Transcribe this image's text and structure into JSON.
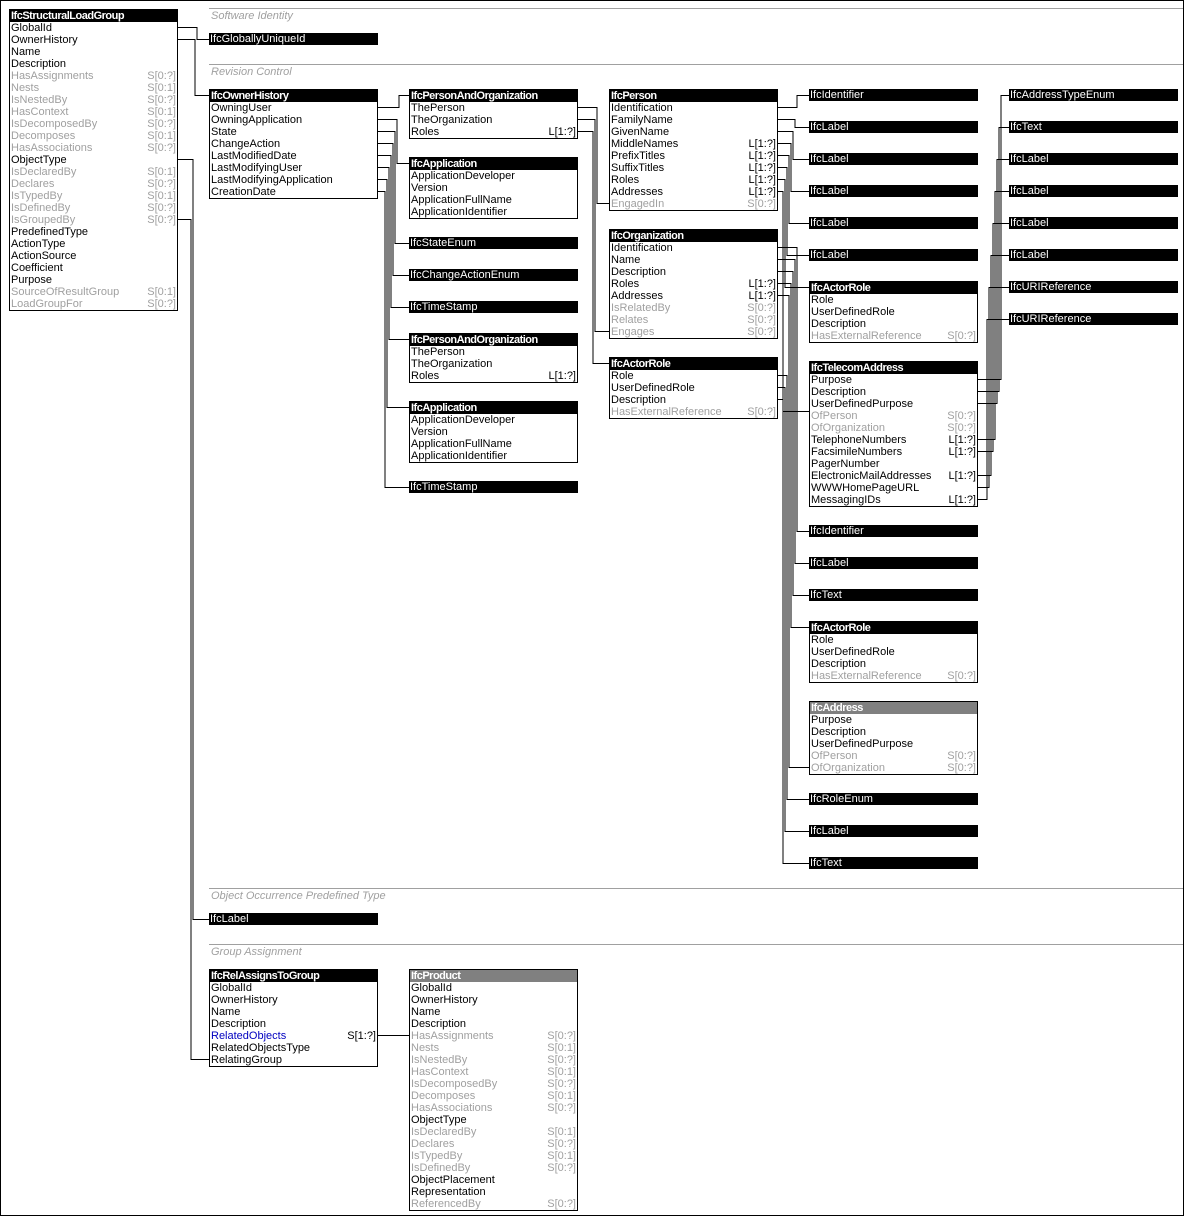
{
  "sections": [
    {
      "id": "software-identity",
      "label": "Software Identity"
    },
    {
      "id": "revision-control",
      "label": "Revision Control"
    },
    {
      "id": "object-occurrence-predefined-type",
      "label": "Object Occurrence Predefined Type"
    },
    {
      "id": "group-assignment",
      "label": "Group Assignment"
    }
  ],
  "entities": {
    "structural_load_group": {
      "name": "IfcStructuralLoadGroup",
      "attributes": [
        {
          "name": "GlobalId",
          "card": "",
          "inverse": false
        },
        {
          "name": "OwnerHistory",
          "card": "",
          "inverse": false
        },
        {
          "name": "Name",
          "card": "",
          "inverse": false
        },
        {
          "name": "Description",
          "card": "",
          "inverse": false
        },
        {
          "name": "HasAssignments",
          "card": "S[0:?]",
          "inverse": true
        },
        {
          "name": "Nests",
          "card": "S[0:1]",
          "inverse": true
        },
        {
          "name": "IsNestedBy",
          "card": "S[0:?]",
          "inverse": true
        },
        {
          "name": "HasContext",
          "card": "S[0:1]",
          "inverse": true
        },
        {
          "name": "IsDecomposedBy",
          "card": "S[0:?]",
          "inverse": true
        },
        {
          "name": "Decomposes",
          "card": "S[0:1]",
          "inverse": true
        },
        {
          "name": "HasAssociations",
          "card": "S[0:?]",
          "inverse": true
        },
        {
          "name": "ObjectType",
          "card": "",
          "inverse": false
        },
        {
          "name": "IsDeclaredBy",
          "card": "S[0:1]",
          "inverse": true
        },
        {
          "name": "Declares",
          "card": "S[0:?]",
          "inverse": true
        },
        {
          "name": "IsTypedBy",
          "card": "S[0:1]",
          "inverse": true
        },
        {
          "name": "IsDefinedBy",
          "card": "S[0:?]",
          "inverse": true
        },
        {
          "name": "IsGroupedBy",
          "card": "S[0:?]",
          "inverse": true
        },
        {
          "name": "PredefinedType",
          "card": "",
          "inverse": false
        },
        {
          "name": "ActionType",
          "card": "",
          "inverse": false
        },
        {
          "name": "ActionSource",
          "card": "",
          "inverse": false
        },
        {
          "name": "Coefficient",
          "card": "",
          "inverse": false
        },
        {
          "name": "Purpose",
          "card": "",
          "inverse": false
        },
        {
          "name": "SourceOfResultGroup",
          "card": "S[0:1]",
          "inverse": true
        },
        {
          "name": "LoadGroupFor",
          "card": "S[0:?]",
          "inverse": true
        }
      ]
    },
    "owner_history": {
      "name": "IfcOwnerHistory",
      "attributes": [
        {
          "name": "OwningUser",
          "card": "",
          "inverse": false
        },
        {
          "name": "OwningApplication",
          "card": "",
          "inverse": false
        },
        {
          "name": "State",
          "card": "",
          "inverse": false
        },
        {
          "name": "ChangeAction",
          "card": "",
          "inverse": false
        },
        {
          "name": "LastModifiedDate",
          "card": "",
          "inverse": false
        },
        {
          "name": "LastModifyingUser",
          "card": "",
          "inverse": false
        },
        {
          "name": "LastModifyingApplication",
          "card": "",
          "inverse": false
        },
        {
          "name": "CreationDate",
          "card": "",
          "inverse": false
        }
      ]
    },
    "person_and_org_1": {
      "name": "IfcPersonAndOrganization",
      "attributes": [
        {
          "name": "ThePerson",
          "card": "",
          "inverse": false
        },
        {
          "name": "TheOrganization",
          "card": "",
          "inverse": false
        },
        {
          "name": "Roles",
          "card": "L[1:?]",
          "inverse": false
        }
      ]
    },
    "application_1": {
      "name": "IfcApplication",
      "attributes": [
        {
          "name": "ApplicationDeveloper",
          "card": "",
          "inverse": false
        },
        {
          "name": "Version",
          "card": "",
          "inverse": false
        },
        {
          "name": "ApplicationFullName",
          "card": "",
          "inverse": false
        },
        {
          "name": "ApplicationIdentifier",
          "card": "",
          "inverse": false
        }
      ]
    },
    "person_and_org_2": {
      "name": "IfcPersonAndOrganization",
      "attributes": [
        {
          "name": "ThePerson",
          "card": "",
          "inverse": false
        },
        {
          "name": "TheOrganization",
          "card": "",
          "inverse": false
        },
        {
          "name": "Roles",
          "card": "L[1:?]",
          "inverse": false
        }
      ]
    },
    "application_2": {
      "name": "IfcApplication",
      "attributes": [
        {
          "name": "ApplicationDeveloper",
          "card": "",
          "inverse": false
        },
        {
          "name": "Version",
          "card": "",
          "inverse": false
        },
        {
          "name": "ApplicationFullName",
          "card": "",
          "inverse": false
        },
        {
          "name": "ApplicationIdentifier",
          "card": "",
          "inverse": false
        }
      ]
    },
    "person": {
      "name": "IfcPerson",
      "attributes": [
        {
          "name": "Identification",
          "card": "",
          "inverse": false
        },
        {
          "name": "FamilyName",
          "card": "",
          "inverse": false
        },
        {
          "name": "GivenName",
          "card": "",
          "inverse": false
        },
        {
          "name": "MiddleNames",
          "card": "L[1:?]",
          "inverse": false
        },
        {
          "name": "PrefixTitles",
          "card": "L[1:?]",
          "inverse": false
        },
        {
          "name": "SuffixTitles",
          "card": "L[1:?]",
          "inverse": false
        },
        {
          "name": "Roles",
          "card": "L[1:?]",
          "inverse": false
        },
        {
          "name": "Addresses",
          "card": "L[1:?]",
          "inverse": false
        },
        {
          "name": "EngagedIn",
          "card": "S[0:?]",
          "inverse": true
        }
      ]
    },
    "organization": {
      "name": "IfcOrganization",
      "attributes": [
        {
          "name": "Identification",
          "card": "",
          "inverse": false
        },
        {
          "name": "Name",
          "card": "",
          "inverse": false
        },
        {
          "name": "Description",
          "card": "",
          "inverse": false
        },
        {
          "name": "Roles",
          "card": "L[1:?]",
          "inverse": false
        },
        {
          "name": "Addresses",
          "card": "L[1:?]",
          "inverse": false
        },
        {
          "name": "IsRelatedBy",
          "card": "S[0:?]",
          "inverse": true
        },
        {
          "name": "Relates",
          "card": "S[0:?]",
          "inverse": true
        },
        {
          "name": "Engages",
          "card": "S[0:?]",
          "inverse": true
        }
      ]
    },
    "actor_role_1": {
      "name": "IfcActorRole",
      "attributes": [
        {
          "name": "Role",
          "card": "",
          "inverse": false
        },
        {
          "name": "UserDefinedRole",
          "card": "",
          "inverse": false
        },
        {
          "name": "Description",
          "card": "",
          "inverse": false
        },
        {
          "name": "HasExternalReference",
          "card": "S[0:?]",
          "inverse": true
        }
      ]
    },
    "actor_role_2": {
      "name": "IfcActorRole",
      "attributes": [
        {
          "name": "Role",
          "card": "",
          "inverse": false
        },
        {
          "name": "UserDefinedRole",
          "card": "",
          "inverse": false
        },
        {
          "name": "Description",
          "card": "",
          "inverse": false
        },
        {
          "name": "HasExternalReference",
          "card": "S[0:?]",
          "inverse": true
        }
      ]
    },
    "telecom_address": {
      "name": "IfcTelecomAddress",
      "attributes": [
        {
          "name": "Purpose",
          "card": "",
          "inverse": false
        },
        {
          "name": "Description",
          "card": "",
          "inverse": false
        },
        {
          "name": "UserDefinedPurpose",
          "card": "",
          "inverse": false
        },
        {
          "name": "OfPerson",
          "card": "S[0:?]",
          "inverse": true
        },
        {
          "name": "OfOrganization",
          "card": "S[0:?]",
          "inverse": true
        },
        {
          "name": "TelephoneNumbers",
          "card": "L[1:?]",
          "inverse": false
        },
        {
          "name": "FacsimileNumbers",
          "card": "L[1:?]",
          "inverse": false
        },
        {
          "name": "PagerNumber",
          "card": "",
          "inverse": false
        },
        {
          "name": "ElectronicMailAddresses",
          "card": "L[1:?]",
          "inverse": false
        },
        {
          "name": "WWWHomePageURL",
          "card": "",
          "inverse": false
        },
        {
          "name": "MessagingIDs",
          "card": "L[1:?]",
          "inverse": false
        }
      ]
    },
    "actor_role_3": {
      "name": "IfcActorRole",
      "attributes": [
        {
          "name": "Role",
          "card": "",
          "inverse": false
        },
        {
          "name": "UserDefinedRole",
          "card": "",
          "inverse": false
        },
        {
          "name": "Description",
          "card": "",
          "inverse": false
        },
        {
          "name": "HasExternalReference",
          "card": "S[0:?]",
          "inverse": true
        }
      ]
    },
    "address": {
      "name": "IfcAddress",
      "abstract": true,
      "attributes": [
        {
          "name": "Purpose",
          "card": "",
          "inverse": false
        },
        {
          "name": "Description",
          "card": "",
          "inverse": false
        },
        {
          "name": "UserDefinedPurpose",
          "card": "",
          "inverse": false
        },
        {
          "name": "OfPerson",
          "card": "S[0:?]",
          "inverse": true
        },
        {
          "name": "OfOrganization",
          "card": "S[0:?]",
          "inverse": true
        }
      ]
    },
    "rel_assigns_to_group": {
      "name": "IfcRelAssignsToGroup",
      "attributes": [
        {
          "name": "GlobalId",
          "card": "",
          "inverse": false
        },
        {
          "name": "OwnerHistory",
          "card": "",
          "inverse": false
        },
        {
          "name": "Name",
          "card": "",
          "inverse": false
        },
        {
          "name": "Description",
          "card": "",
          "inverse": false
        },
        {
          "name": "RelatedObjects",
          "card": "S[1:?]",
          "inverse": false,
          "highlight": true
        },
        {
          "name": "RelatedObjectsType",
          "card": "",
          "inverse": false
        },
        {
          "name": "RelatingGroup",
          "card": "",
          "inverse": false
        }
      ]
    },
    "product": {
      "name": "IfcProduct",
      "abstract": true,
      "attributes": [
        {
          "name": "GlobalId",
          "card": "",
          "inverse": false
        },
        {
          "name": "OwnerHistory",
          "card": "",
          "inverse": false
        },
        {
          "name": "Name",
          "card": "",
          "inverse": false
        },
        {
          "name": "Description",
          "card": "",
          "inverse": false
        },
        {
          "name": "HasAssignments",
          "card": "S[0:?]",
          "inverse": true
        },
        {
          "name": "Nests",
          "card": "S[0:1]",
          "inverse": true
        },
        {
          "name": "IsNestedBy",
          "card": "S[0:?]",
          "inverse": true
        },
        {
          "name": "HasContext",
          "card": "S[0:1]",
          "inverse": true
        },
        {
          "name": "IsDecomposedBy",
          "card": "S[0:?]",
          "inverse": true
        },
        {
          "name": "Decomposes",
          "card": "S[0:1]",
          "inverse": true
        },
        {
          "name": "HasAssociations",
          "card": "S[0:?]",
          "inverse": true
        },
        {
          "name": "ObjectType",
          "card": "",
          "inverse": false
        },
        {
          "name": "IsDeclaredBy",
          "card": "S[0:1]",
          "inverse": true
        },
        {
          "name": "Declares",
          "card": "S[0:?]",
          "inverse": true
        },
        {
          "name": "IsTypedBy",
          "card": "S[0:1]",
          "inverse": true
        },
        {
          "name": "IsDefinedBy",
          "card": "S[0:?]",
          "inverse": true
        },
        {
          "name": "ObjectPlacement",
          "card": "",
          "inverse": false
        },
        {
          "name": "Representation",
          "card": "",
          "inverse": false
        },
        {
          "name": "ReferencedBy",
          "card": "S[0:?]",
          "inverse": true
        }
      ]
    }
  },
  "types": {
    "globally_unique_id": "IfcGloballyUniqueId",
    "state_enum": "IfcStateEnum",
    "change_action_enum": "IfcChangeActionEnum",
    "timestamp_1": "IfcTimeStamp",
    "timestamp_2": "IfcTimeStamp",
    "identifier_1": "IfcIdentifier",
    "label_1": "IfcLabel",
    "label_2": "IfcLabel",
    "label_3": "IfcLabel",
    "label_4": "IfcLabel",
    "label_5": "IfcLabel",
    "identifier_2": "IfcIdentifier",
    "label_6": "IfcLabel",
    "text_1": "IfcText",
    "role_enum": "IfcRoleEnum",
    "label_7": "IfcLabel",
    "text_2": "IfcText",
    "address_type_enum": "IfcAddressTypeEnum",
    "text_3": "IfcText",
    "label_8": "IfcLabel",
    "label_9": "IfcLabel",
    "label_10": "IfcLabel",
    "label_11": "IfcLabel",
    "uri_reference_1": "IfcURIReference",
    "uri_reference_2": "IfcURIReference",
    "label_12": "IfcLabel"
  }
}
